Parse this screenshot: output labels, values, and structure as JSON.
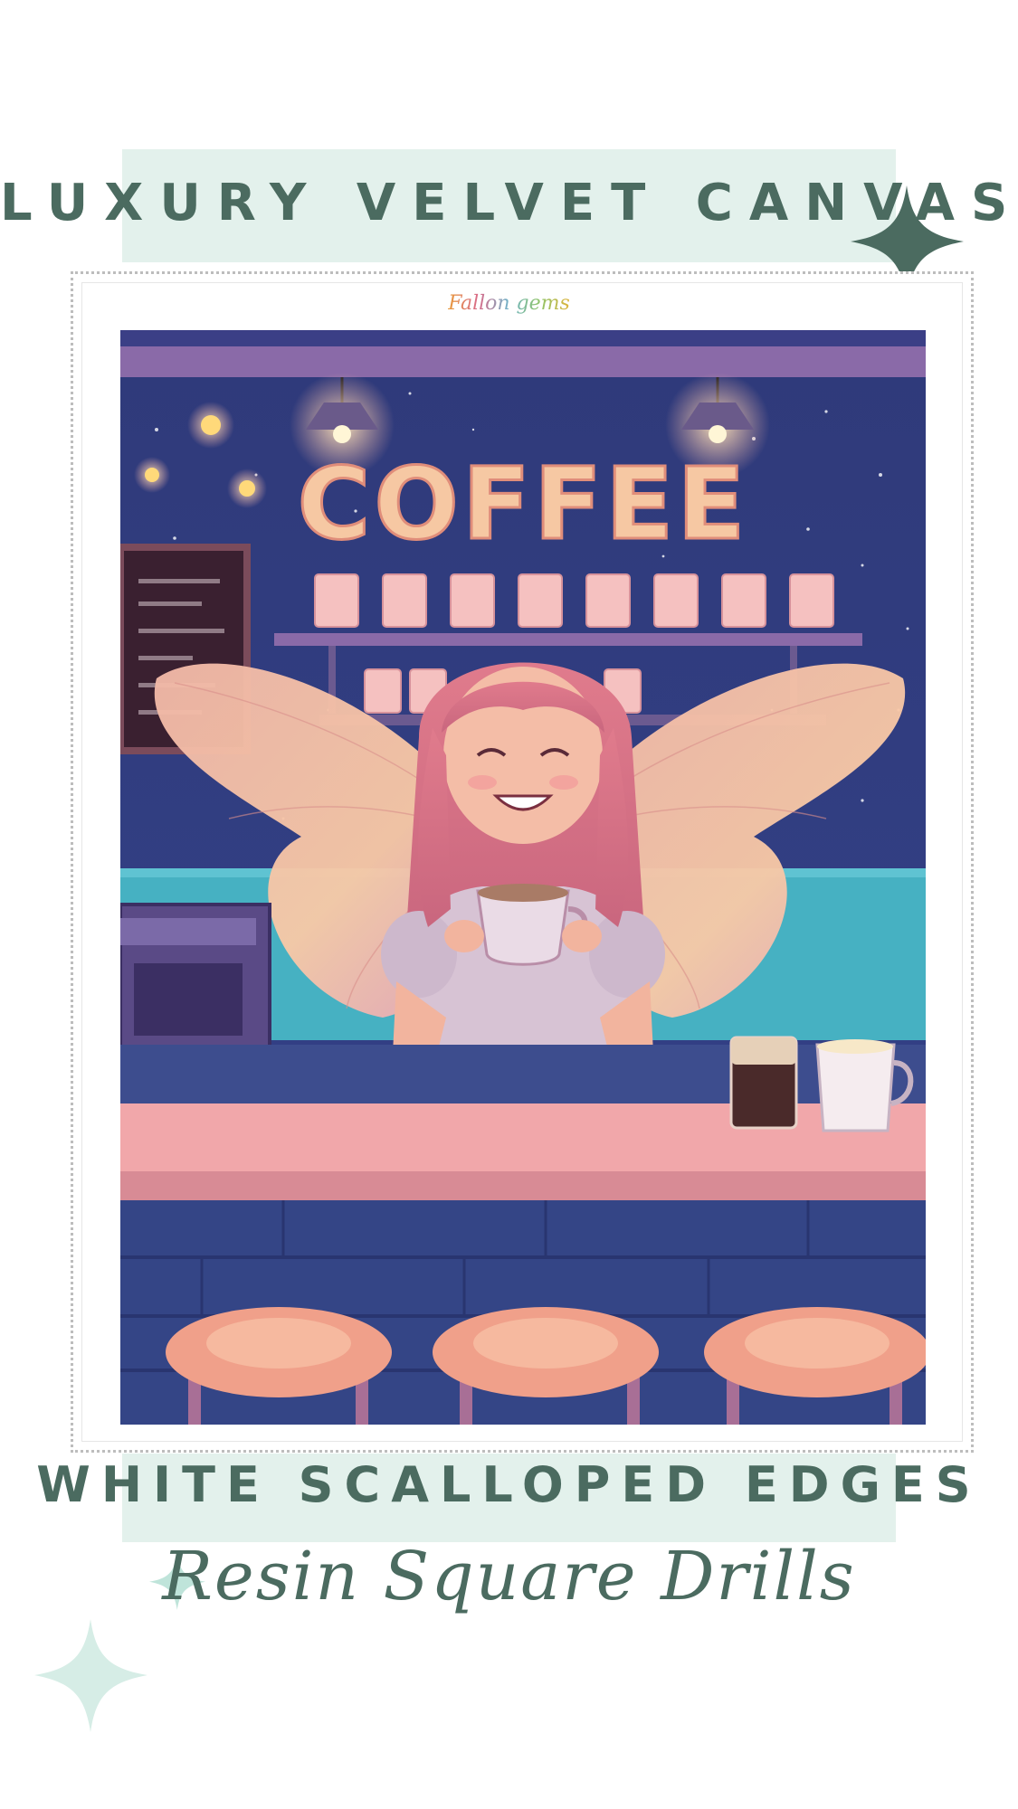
{
  "header": {
    "title": "LUXURY VELVET CANVAS"
  },
  "brand": {
    "name": "Fallon gems"
  },
  "artwork": {
    "sign_text": "COFFEE",
    "subject": "fairy barista holding a coffee cup"
  },
  "footer": {
    "feature": "WHITE SCALLOPED EDGES",
    "drills": "Resin Square Drills"
  },
  "colors": {
    "heading": "#4b6b60",
    "band": "#e3f1ec",
    "sparkle_dark": "#4b6b60",
    "sparkle_light": "#d6ede6"
  }
}
